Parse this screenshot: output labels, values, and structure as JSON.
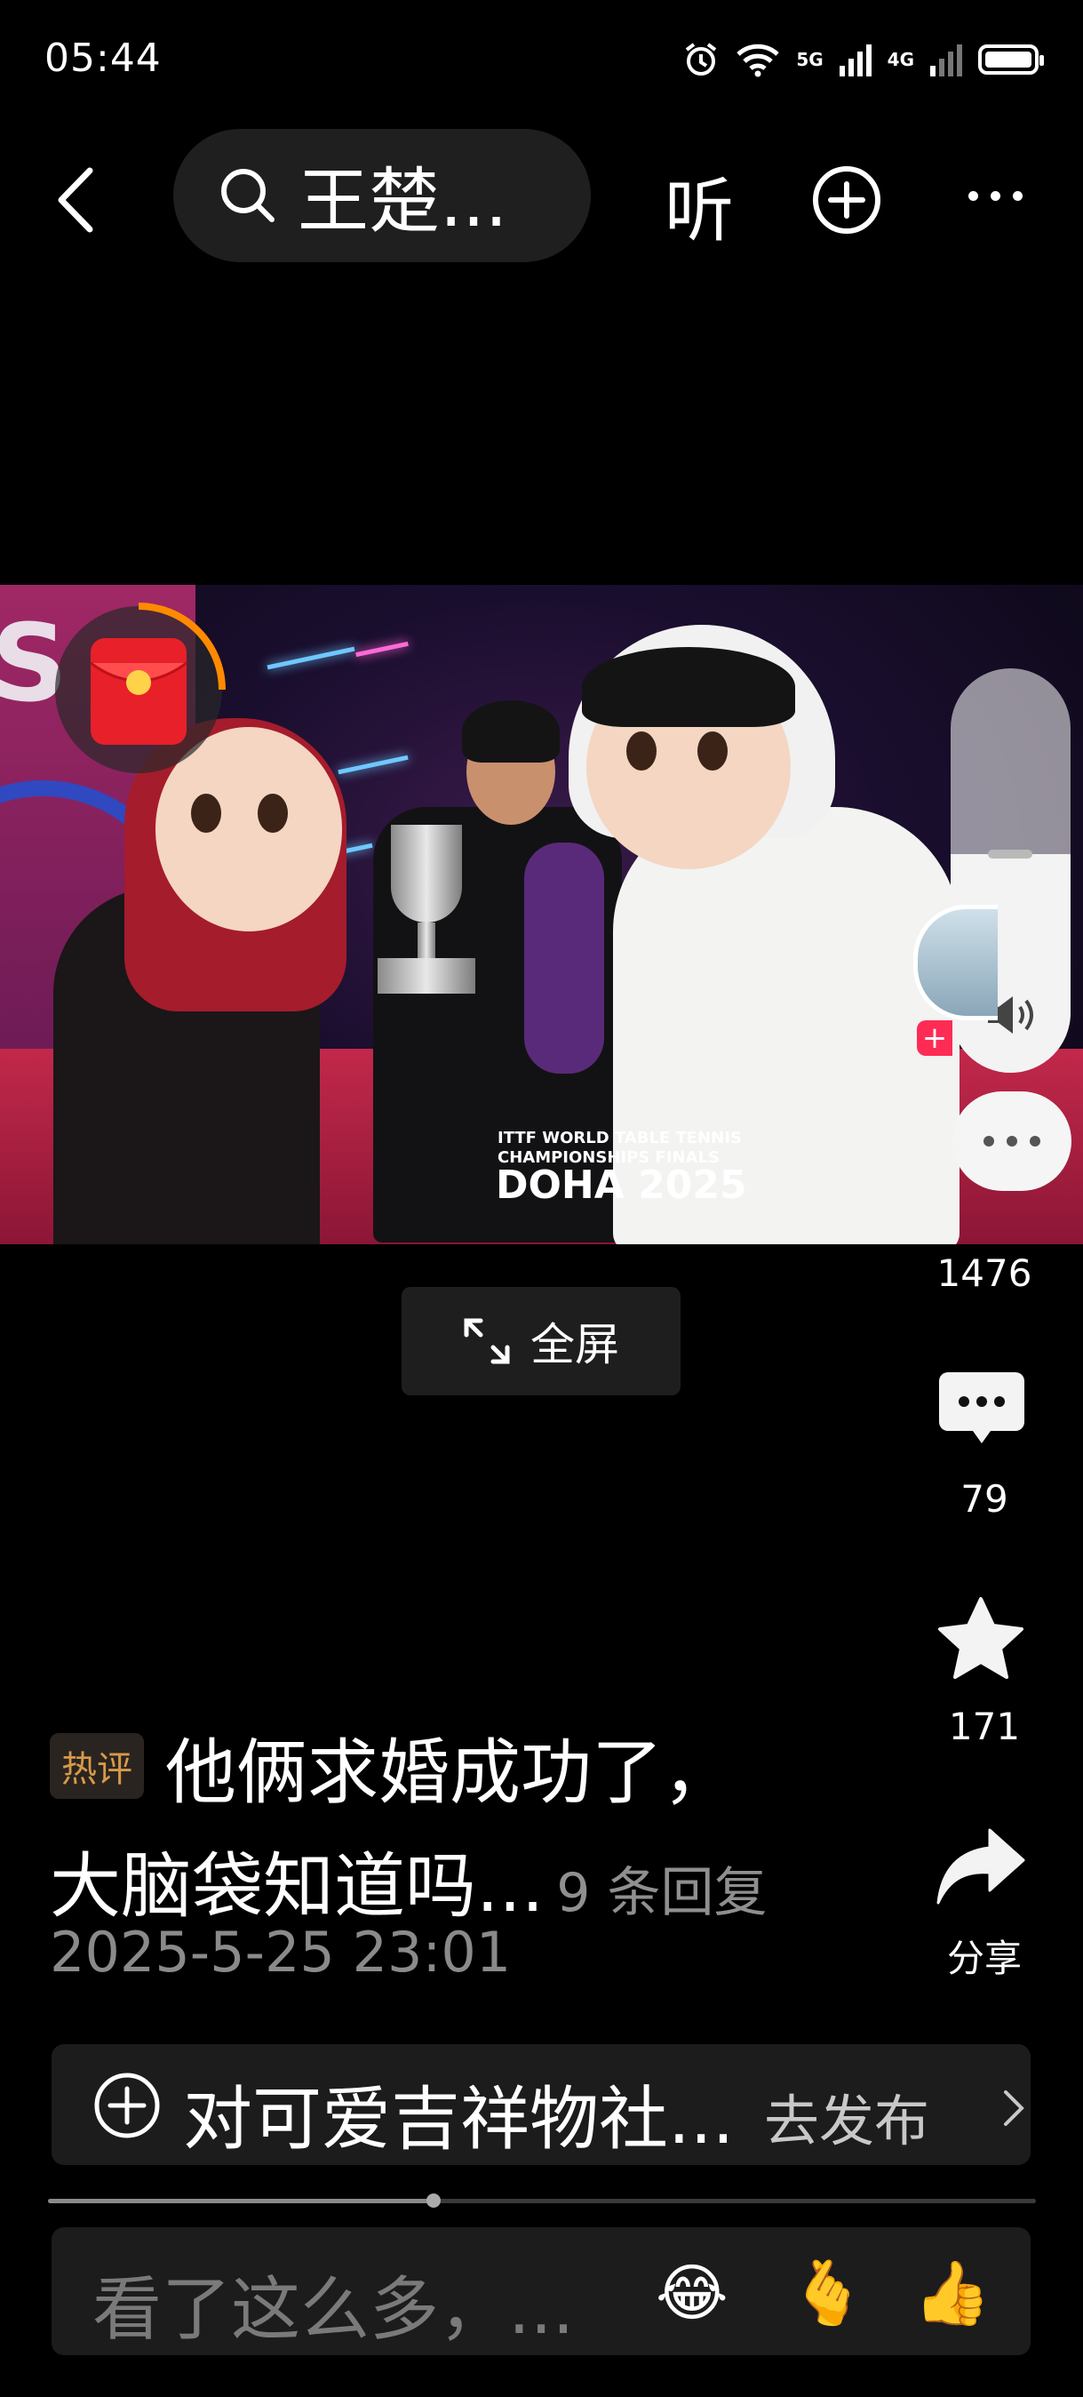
{
  "status_bar": {
    "time": "05:44",
    "network_primary": "5G",
    "network_secondary": "4G"
  },
  "nav": {
    "search_text": "王楚...",
    "listen_label": "听"
  },
  "video": {
    "banner_line1": "ITTF WORLD TABLE TENNIS",
    "banner_line2": "CHAMPIONSHIPS FINALS",
    "banner_city": "DOHA 2025",
    "letter": "S",
    "volume_level": 0.54
  },
  "fullscreen_label": "全屏",
  "actions": {
    "like_count": "1476",
    "comment_count": "79",
    "favorite_count": "171",
    "share_label": "分享"
  },
  "hot_comment": {
    "badge": "热评",
    "line1": "他俩求婚成功了，",
    "line2": "大脑袋知道吗...",
    "reply_count": "9 条回复",
    "date": "2025-5-25 23:01"
  },
  "publish": {
    "text": "对可爱吉祥物社...",
    "action": "去发布"
  },
  "progress": {
    "fraction": 0.39
  },
  "comment_input": {
    "placeholder": "看了这么多，...",
    "emojis": [
      "😂",
      "🫰",
      "👍"
    ]
  },
  "colors": {
    "badge_text": "#d79a4a",
    "accent_red": "#fe2c55"
  }
}
